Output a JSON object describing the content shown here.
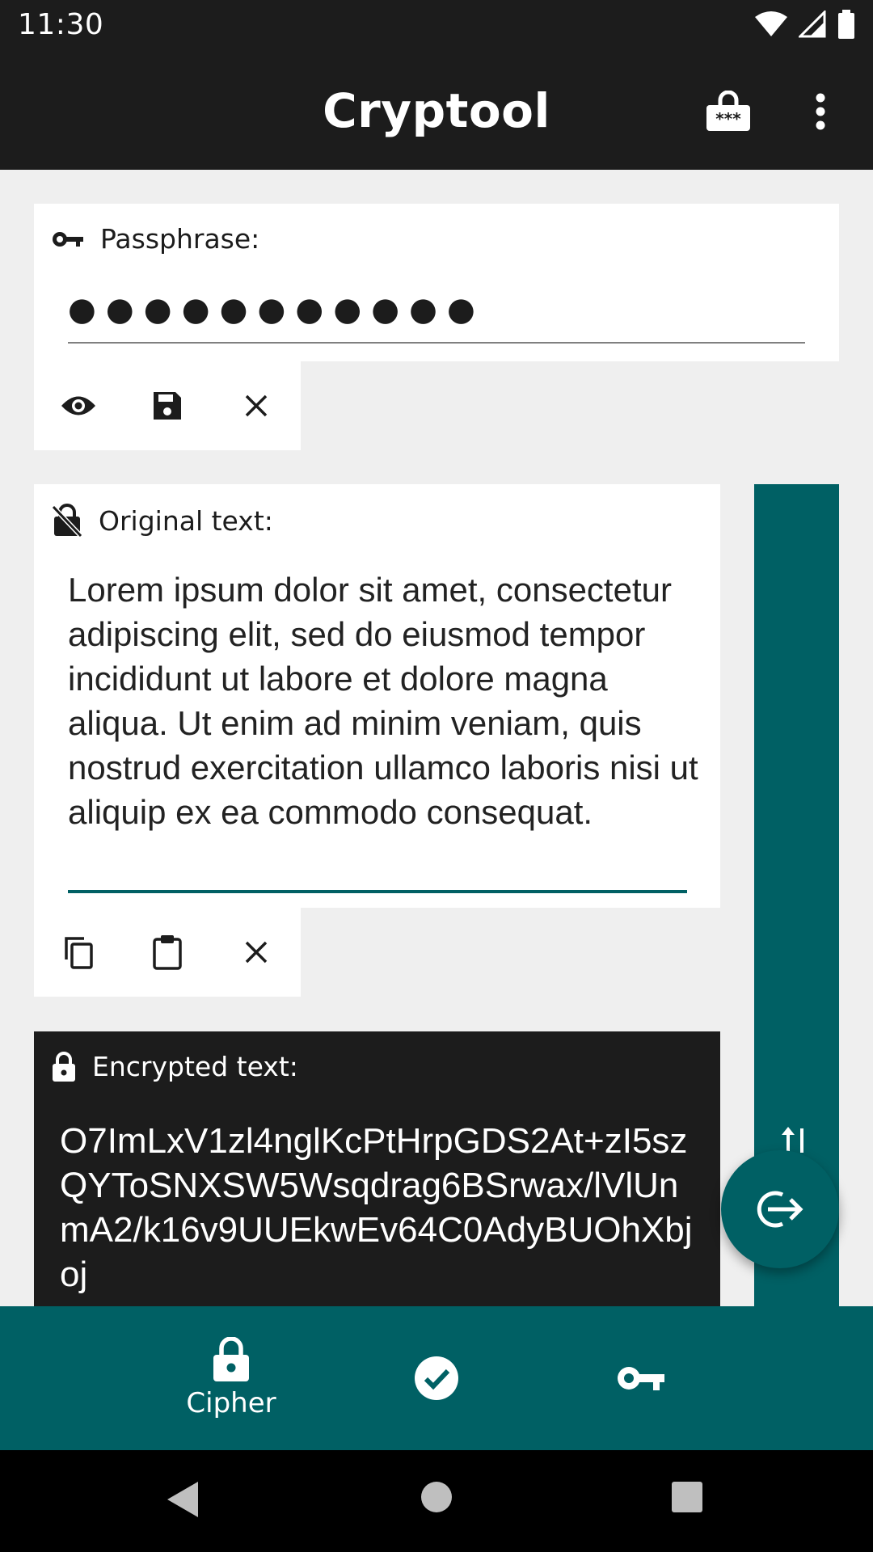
{
  "status_bar": {
    "time": "11:30"
  },
  "app_bar": {
    "title": "Cryptool"
  },
  "passphrase": {
    "label": "Passphrase:",
    "value": "●●●●●●●●●●●"
  },
  "original": {
    "label": "Original text:",
    "text": "Lorem ipsum dolor sit amet, consectetur adipiscing elit, sed do eiusmod tempor incididunt ut labore et dolore magna aliqua. Ut enim ad minim veniam, quis nostrud exercitation ullamco laboris nisi ut aliquip ex ea commodo consequat."
  },
  "encrypted": {
    "label": "Encrypted text:",
    "text": "O7ImLxV1zl4nglKcPtHrpGDS2At+zI5szQYToSNXSW5Wsqdrag6BSrwax/lVlUnmA2/k16v9UUEkwEv64C0AdyBUOhXbjoj"
  },
  "bottom_nav": {
    "cipher_label": "Cipher"
  },
  "colors": {
    "accent": "#006064",
    "dark": "#1c1c1c",
    "background": "#efefef"
  }
}
